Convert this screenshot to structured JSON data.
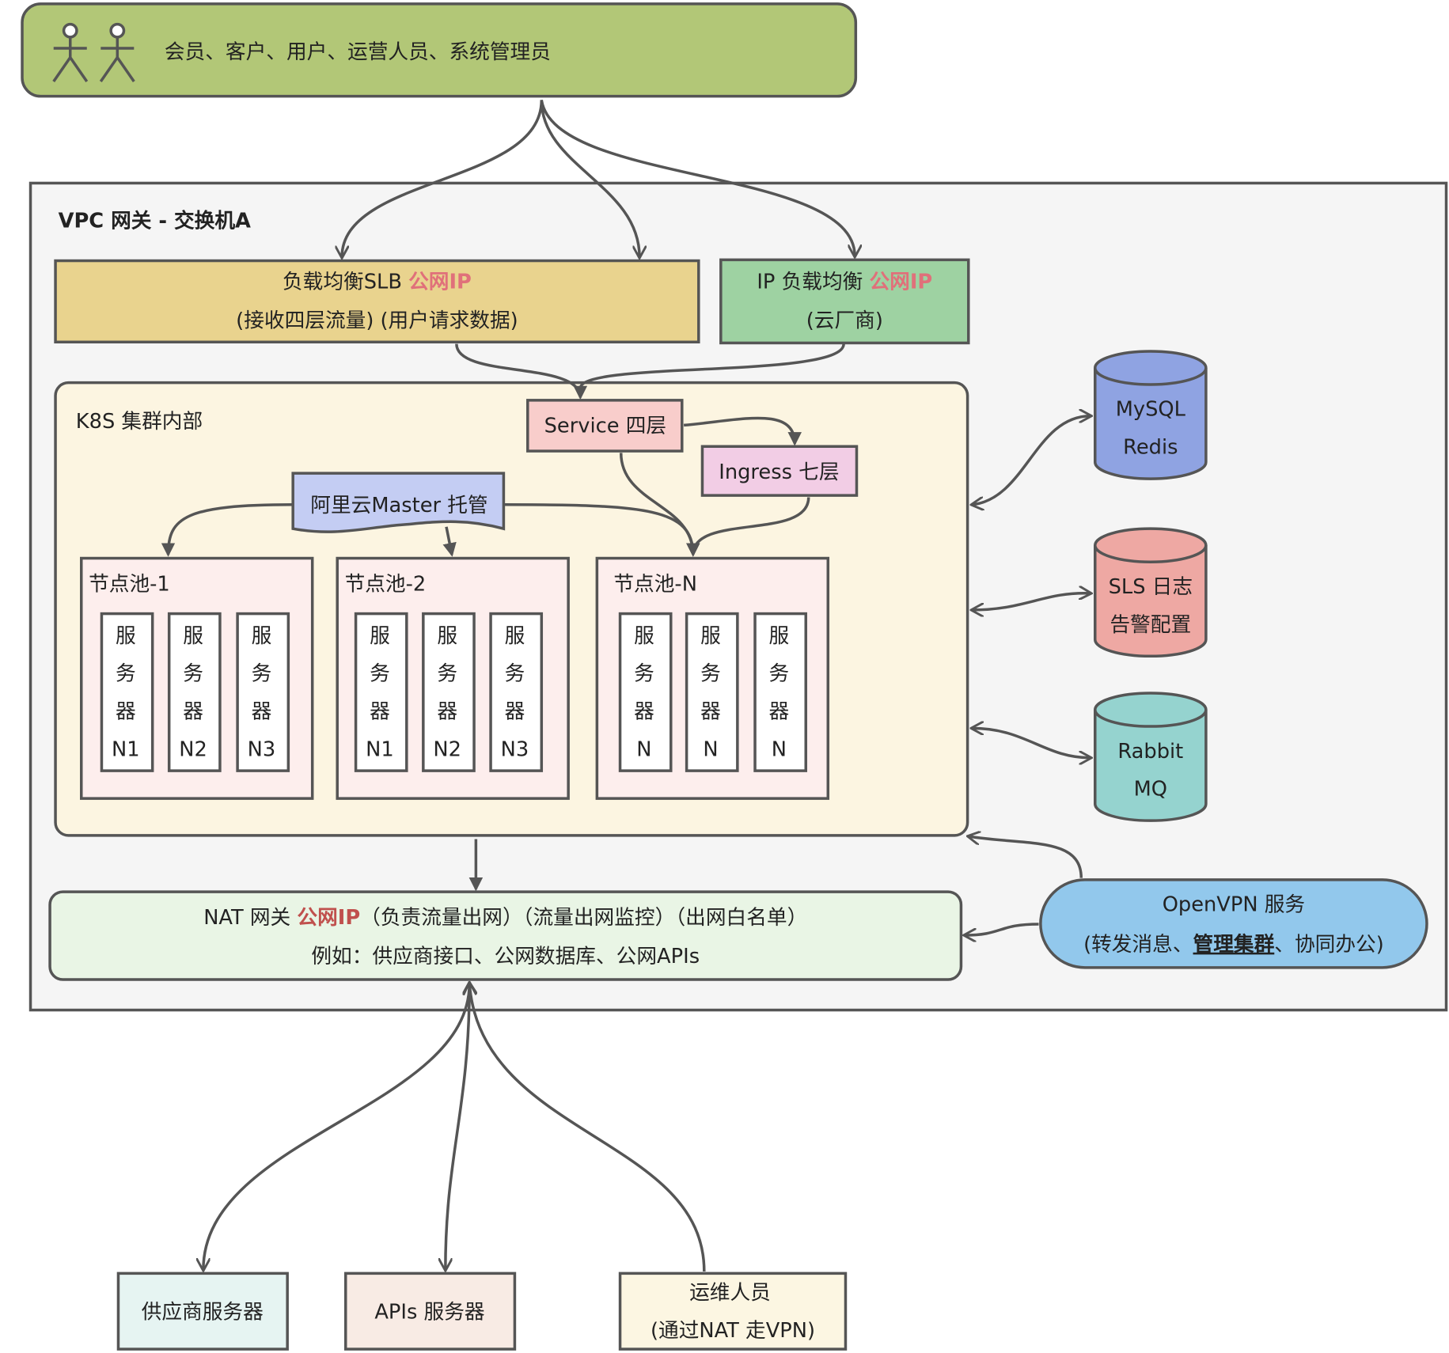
{
  "colors": {
    "users": "#b2c777",
    "vpc": "#f5f5f5",
    "slb": "#e9d38e",
    "iplb": "#9ed2a2",
    "k8s": "#fcf5e1",
    "service": "#f8cdcb",
    "ingress": "#f2cde5",
    "master": "#c4cdf3",
    "pool": "#fdeeed",
    "mysql": "#8fa3e2",
    "sls": "#eea8a3",
    "rabbit": "#95d3cf",
    "nat": "#e9f5e5",
    "openvpn": "#92c8ec",
    "public_ip": "#e0707a"
  },
  "users": {
    "icon": "person-icon",
    "label": "会员、客户、用户、运营人员、系统管理员"
  },
  "vpc": {
    "title": "VPC 网关 - 交换机A"
  },
  "slb": {
    "line1": "负载均衡SLB ",
    "public_ip": "公网IP",
    "line2": "(接收四层流量) (用户请求数据)"
  },
  "iplb": {
    "line1": "IP 负载均衡 ",
    "public_ip": "公网IP",
    "line2": "(云厂商)"
  },
  "k8s": {
    "title": "K8S 集群内部",
    "service": "Service 四层",
    "ingress": "Ingress 七层",
    "master": "阿里云Master 托管",
    "pools": [
      {
        "title": "节点池-1",
        "servers": [
          [
            "服",
            "务",
            "器",
            "N1"
          ],
          [
            "服",
            "务",
            "器",
            "N2"
          ],
          [
            "服",
            "务",
            "器",
            "N3"
          ]
        ]
      },
      {
        "title": "节点池-2",
        "servers": [
          [
            "服",
            "务",
            "器",
            "N1"
          ],
          [
            "服",
            "务",
            "器",
            "N2"
          ],
          [
            "服",
            "务",
            "器",
            "N3"
          ]
        ]
      },
      {
        "title": "节点池-N",
        "servers": [
          [
            "服",
            "务",
            "器",
            "N"
          ],
          [
            "服",
            "务",
            "器",
            "N"
          ],
          [
            "服",
            "务",
            "器",
            "N"
          ]
        ]
      }
    ]
  },
  "stores": [
    {
      "line1": "MySQL",
      "line2": "Redis"
    },
    {
      "line1": "SLS 日志",
      "line2": "告警配置"
    },
    {
      "line1": "Rabbit",
      "line2": "MQ"
    }
  ],
  "nat": {
    "prefix": "NAT 网关 ",
    "public_ip": "公网IP",
    "suffix": "（负责流量出网）（流量出网监控）（出网白名单）",
    "line2": "例如：供应商接口、公网数据库、公网APIs"
  },
  "openvpn": {
    "line1": "OpenVPN 服务",
    "line2_a": "(转发消息、",
    "line2_link": "管理集群",
    "line2_b": "、协同办公)"
  },
  "external": [
    {
      "line1": "供应商服务器"
    },
    {
      "line1": "APIs 服务器"
    },
    {
      "line1": "运维人员",
      "line2": "(通过NAT 走VPN)"
    }
  ]
}
